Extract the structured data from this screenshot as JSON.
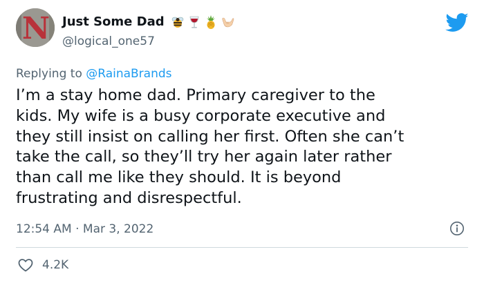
{
  "tweet": {
    "author": {
      "display_name": "Just Some Dad",
      "handle": "@logical_one57",
      "avatar_letter": "N",
      "name_emojis": [
        "bee-emoji",
        "wine-glass-emoji",
        "pineapple-emoji",
        "call-me-hand-emoji"
      ]
    },
    "replying_to": {
      "prefix": "Replying to",
      "mention": "@RainaBrands"
    },
    "text_lines": [
      "I’m a stay home dad. Primary caregiver to the",
      "kids. My wife is a busy corporate executive and",
      "they still insist on calling her first. Often she can’t",
      "take the call, so they’ll try her again later rather",
      "than call me like they should. It is beyond",
      "frustrating and disrespectful."
    ],
    "timestamp": "12:54 AM · Mar 3, 2022",
    "likes": "4.2K"
  },
  "colors": {
    "text": "#0f1419",
    "secondary": "#536471",
    "link": "#1d9bf0",
    "twitter_blue": "#1d9bf0",
    "divider": "#cfd9de",
    "avatar_letter": "#b8323a"
  }
}
